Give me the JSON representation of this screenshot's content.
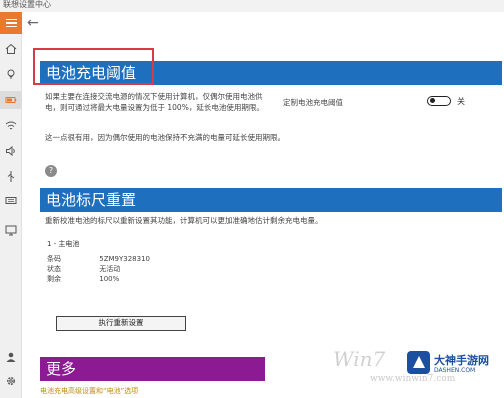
{
  "window": {
    "title": "联想设置中心"
  },
  "sidebar": {
    "icons": [
      "home-icon",
      "lightbulb-icon",
      "battery-icon",
      "network-icon",
      "audio-icon",
      "usb-icon",
      "keyboard-icon",
      "display-icon",
      "user-icon",
      "settings-icon"
    ]
  },
  "section1": {
    "title": "电池充电阈值",
    "description": "如果主要在连接交流电源的情况下使用计算机，仅偶尔使用电池供电，则可通过将最大电量设置为低于 100%，延长电池使用期限。",
    "toggle_label": "定制电池充电阈值",
    "toggle_state": "关",
    "note": "这一点很有用，因为偶尔使用的电池保持不充满的电量可延长使用期限。"
  },
  "section2": {
    "title": "电池标尺重置",
    "description": "重新校准电池的标尺以重新设置其功能，计算机可以更加准确地估计剩余充电电量。",
    "battery_header": "1 - 主电池",
    "rows": [
      {
        "key": "条码",
        "value": "5ZM9Y328310"
      },
      {
        "key": "状态",
        "value": "无活动"
      },
      {
        "key": "剩余",
        "value": "100%"
      }
    ],
    "button_label": "执行重新设置"
  },
  "section3": {
    "title": "更多",
    "link": "电池充电高级设置和“电池”选项"
  },
  "watermark": {
    "text": "Win7",
    "sub": "www.winwin7.com",
    "brand": "大神手游网",
    "brand_url": "DASHEN.COM"
  },
  "colors": {
    "accent": "#e8792f",
    "banner_blue": "#1f6fbf",
    "banner_purple": "#8b1a93",
    "highlight": "#d83a4a"
  }
}
